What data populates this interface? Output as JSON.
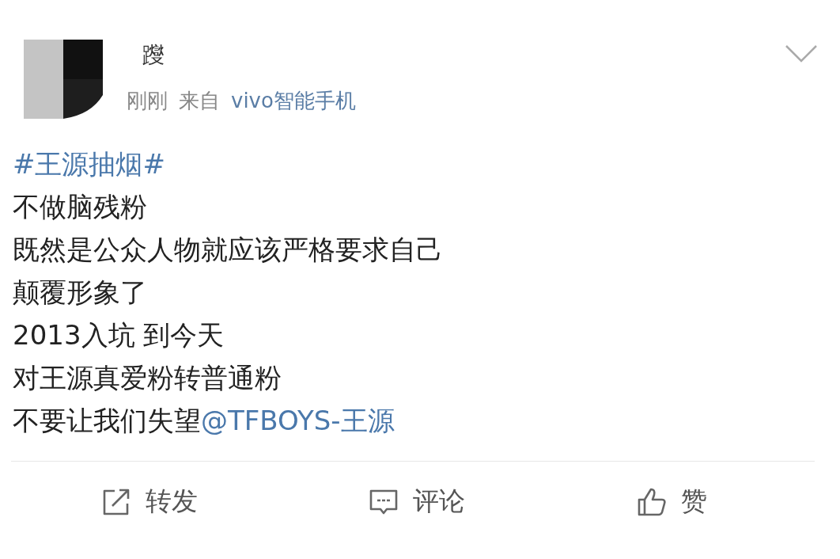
{
  "post": {
    "author": {
      "name": "躞",
      "time": "刚刚",
      "source_prefix": "来自",
      "source": "vivo智能手机"
    },
    "lines": [
      [
        {
          "kind": "hashtag",
          "text": "#王源抽烟#"
        }
      ],
      [
        {
          "kind": "text",
          "text": "不做脑残粉"
        }
      ],
      [
        {
          "kind": "text",
          "text": "既然是公众人物就应该严格要求自己"
        }
      ],
      [
        {
          "kind": "text",
          "text": "颠覆形象了"
        }
      ],
      [
        {
          "kind": "text",
          "text": "2013入坑 到今天"
        }
      ],
      [
        {
          "kind": "text",
          "text": "对王源真爱粉转普通粉"
        }
      ],
      [
        {
          "kind": "text",
          "text": "不要让我们失望"
        },
        {
          "kind": "mention",
          "text": "@TFBOYS-王源"
        }
      ]
    ],
    "actions": [
      {
        "kind": "repost",
        "label": "转发"
      },
      {
        "kind": "comment",
        "label": "评论"
      },
      {
        "kind": "like",
        "label": "赞"
      }
    ]
  }
}
